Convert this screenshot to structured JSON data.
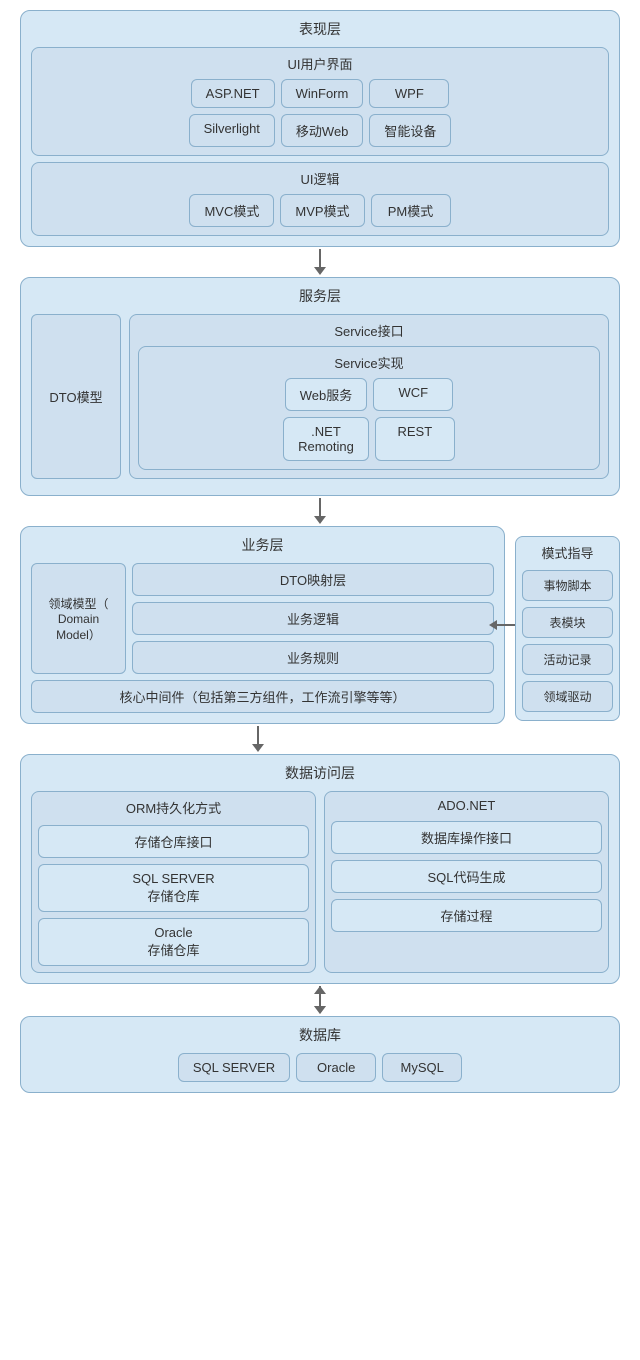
{
  "layers": {
    "presentation": {
      "title": "表现层",
      "ui_section": {
        "title": "UI用户界面",
        "row1": [
          "ASP.NET",
          "WinForm",
          "WPF"
        ],
        "row2": [
          "Silverlight",
          "移动Web",
          "智能设备"
        ]
      },
      "logic_section": {
        "title": "UI逻辑",
        "items": [
          "MVC模式",
          "MVP模式",
          "PM模式"
        ]
      }
    },
    "service": {
      "title": "服务层",
      "dto": "DTO模型",
      "service_interface": "Service接口",
      "service_impl": {
        "title": "Service实现",
        "items": [
          "Web服务",
          "WCF",
          ".NET\nRemoting",
          "REST"
        ]
      }
    },
    "business": {
      "title": "业务层",
      "domain_model": "领域模型（\nDomain\nModel）",
      "dto_mapping": "DTO映射层",
      "logic": "业务逻辑",
      "rules": "业务规则",
      "core": "核心中间件（包括第三方组件，工作流引擎等等）",
      "side_panel": {
        "title": "模式指导",
        "items": [
          "事物脚本",
          "表模块",
          "活动记录",
          "领域驱动"
        ]
      }
    },
    "data_access": {
      "title": "数据访问层",
      "orm_col": {
        "title": "ORM持久化方式",
        "items": [
          "存储仓库接口",
          "SQL SERVER\n存储仓库",
          "Oracle\n存储仓库"
        ]
      },
      "ado_col": {
        "title": "ADO.NET",
        "items": [
          "数据库操作接口",
          "SQL代码生成",
          "存储过程"
        ]
      }
    },
    "database": {
      "title": "数据库",
      "items": [
        "SQL SERVER",
        "Oracle",
        "MySQL"
      ]
    }
  }
}
